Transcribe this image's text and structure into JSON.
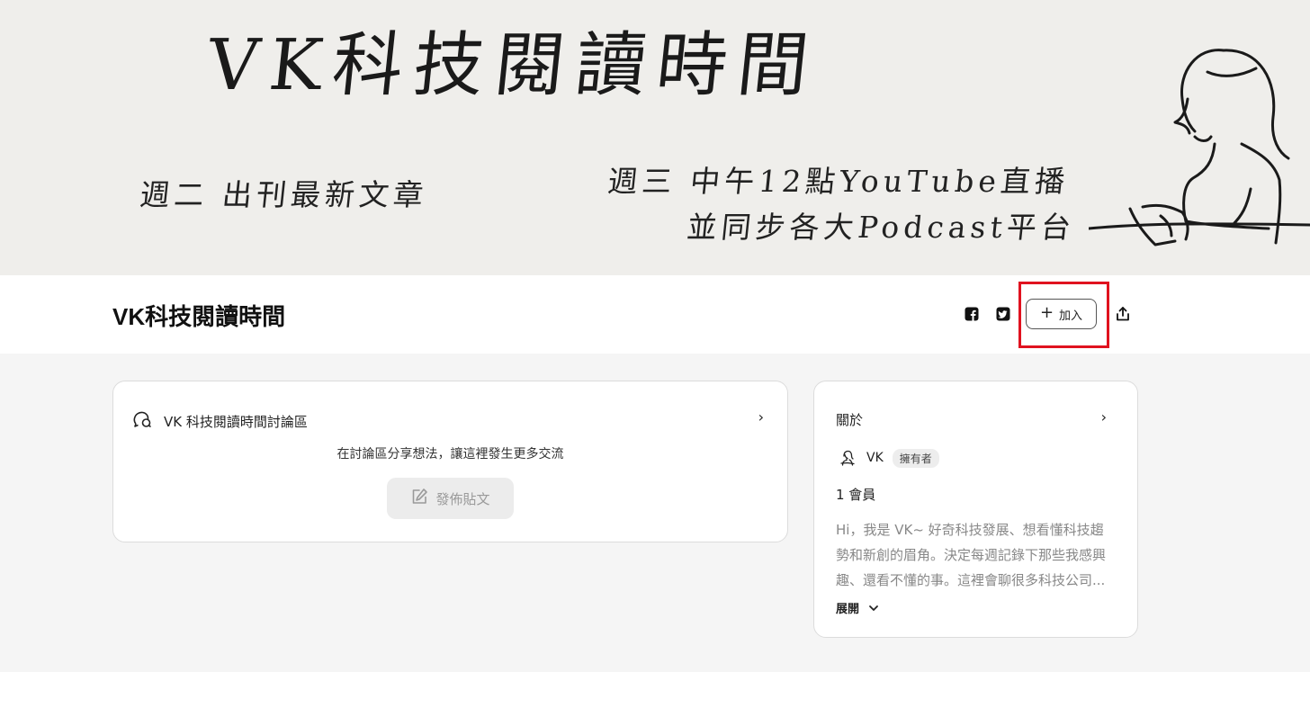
{
  "banner": {
    "title": "VK科技閱讀時間",
    "line1": "週二 出刊最新文章",
    "line2": "週三 中午12點YouTube直播",
    "line3": "並同步各大Podcast平台"
  },
  "header": {
    "title": "VK科技閱讀時間",
    "join_label": "加入",
    "join_plus": "+"
  },
  "discussion": {
    "title": "VK 科技閱讀時間討論區",
    "subtitle": "在討論區分享想法，讓這裡發生更多交流",
    "post_label": "發佈貼文",
    "chevron": "›"
  },
  "about": {
    "title": "關於",
    "chevron": "›",
    "owner_name": "VK",
    "owner_badge": "擁有者",
    "members": "1 會員",
    "description": "Hi，我是 VK~ 好奇科技發展、想看懂科技趨勢和新創的眉角。決定每週記錄下那些我感興趣、還看不懂的事。這裡會聊很多科技公司...",
    "expand_label": "展開",
    "expand_chevron": "⌄"
  },
  "colors": {
    "highlight": "#e0121f",
    "banner_bg": "#efeeeb",
    "content_bg": "#f5f5f5"
  },
  "icons": {
    "facebook": "facebook-icon",
    "twitter": "twitter-icon",
    "share": "share-icon",
    "discussion": "chat-bubble-icon",
    "post": "edit-icon",
    "avatar": "person-avatar-icon"
  }
}
